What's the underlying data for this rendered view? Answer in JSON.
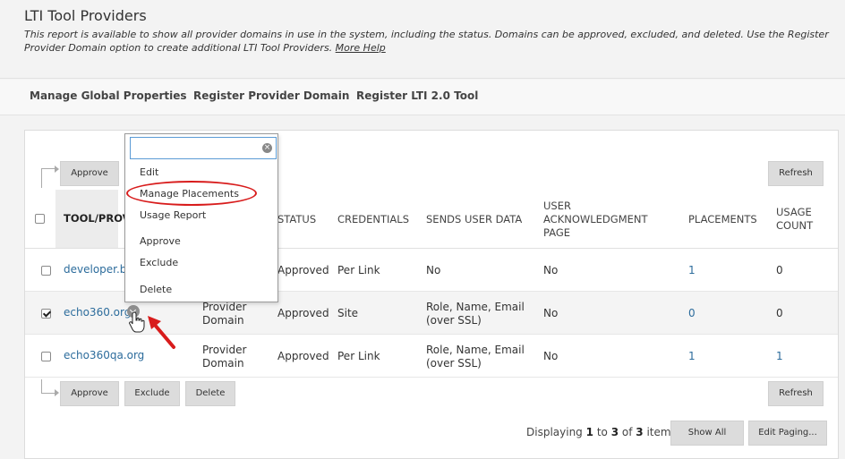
{
  "header": {
    "title": "LTI Tool Providers",
    "description": "This report is available to show all provider domains in use in the system, including the status. Domains can be approved, excluded, and deleted. Use the Register Provider Domain option to create additional LTI Tool Providers.",
    "help_link": "More Help"
  },
  "nav": {
    "manage_global": "Manage Global Properties",
    "register_domain": "Register Provider Domain",
    "register_lti2": "Register LTI 2.0 Tool"
  },
  "top_actions": {
    "approve": "Approve",
    "refresh": "Refresh"
  },
  "bottom_actions": {
    "approve": "Approve",
    "exclude": "Exclude",
    "delete": "Delete",
    "refresh": "Refresh"
  },
  "table": {
    "headers": {
      "tool": "TOOL/PROV",
      "status": "STATUS",
      "credentials": "CREDENTIALS",
      "sends": "SENDS USER DATA",
      "ack_1": "USER",
      "ack_2": "ACKNOWLEDGMENT",
      "ack_3": "PAGE",
      "placements": "PLACEMENTS",
      "usage_1": "USAGE",
      "usage_2": "COUNT"
    },
    "rows": [
      {
        "name": "developer.bla",
        "type_1": "",
        "type_2": "",
        "status": "Approved",
        "credentials": "Per Link",
        "sends_1": "No",
        "sends_2": "",
        "ack": "No",
        "placements": "1",
        "usage": "0",
        "checked": false
      },
      {
        "name": "echo360.org",
        "type_1": "Provider",
        "type_2": "Domain",
        "status": "Approved",
        "credentials": "Site",
        "sends_1": "Role, Name, Email",
        "sends_2": "(over SSL)",
        "ack": "No",
        "placements": "0",
        "usage": "0",
        "checked": true
      },
      {
        "name": "echo360qa.org",
        "type_1": "Provider",
        "type_2": "Domain",
        "status": "Approved",
        "credentials": "Per Link",
        "sends_1": "Role, Name, Email",
        "sends_2": "(over SSL)",
        "ack": "No",
        "placements": "1",
        "usage": "1",
        "checked": false
      }
    ]
  },
  "dropdown": {
    "search_value": "",
    "items": [
      "Edit",
      "Manage Placements",
      "Usage Report",
      "Approve",
      "Exclude",
      "Delete"
    ]
  },
  "paging": {
    "prefix": "Displaying",
    "from": "1",
    "to_word": "to",
    "to": "3",
    "of_word": "of",
    "total": "3",
    "suffix": "items",
    "show_all": "Show All",
    "edit_paging": "Edit Paging..."
  },
  "colors": {
    "link": "#2c6c9c",
    "highlight": "#d81c1c",
    "button": "#dcdcdc"
  }
}
